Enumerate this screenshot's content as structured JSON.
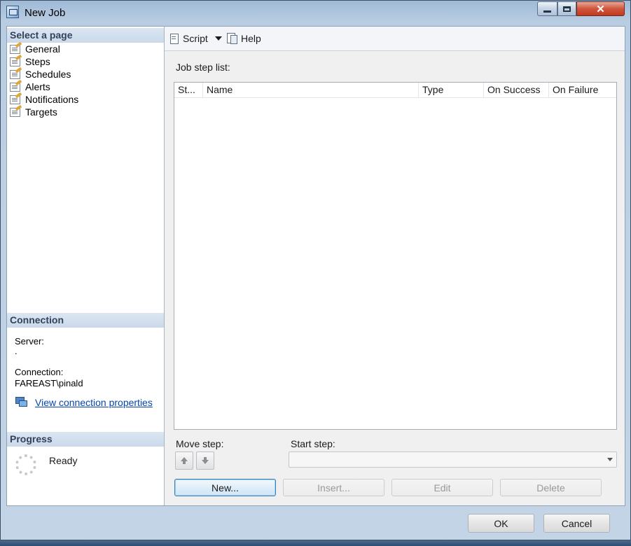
{
  "window": {
    "title": "New Job",
    "min_label": "",
    "max_label": "",
    "close_label": "✕"
  },
  "left_panel": {
    "select_page_heading": "Select a page",
    "pages": [
      {
        "label": "General"
      },
      {
        "label": "Steps"
      },
      {
        "label": "Schedules"
      },
      {
        "label": "Alerts"
      },
      {
        "label": "Notifications"
      },
      {
        "label": "Targets"
      }
    ],
    "connection_heading": "Connection",
    "server_label": "Server:",
    "server_value": ".",
    "connection_label": "Connection:",
    "connection_value": "FAREAST\\pinald",
    "view_connection_link": "View connection properties",
    "progress_heading": "Progress",
    "progress_status": "Ready"
  },
  "toolbar": {
    "script_label": "Script",
    "help_label": "Help"
  },
  "job_steps": {
    "caption": "Job step list:",
    "columns": [
      "St...",
      "Name",
      "Type",
      "On Success",
      "On Failure"
    ],
    "rows": []
  },
  "move_step_label": "Move step:",
  "start_step_label": "Start step:",
  "start_step_value": "",
  "buttons": {
    "new": "New...",
    "insert": "Insert...",
    "edit": "Edit",
    "delete": "Delete",
    "ok": "OK",
    "cancel": "Cancel"
  },
  "colors": {
    "section_header_bg": "#cad9ea",
    "link": "#0645ad",
    "close_button": "#c23a21"
  }
}
